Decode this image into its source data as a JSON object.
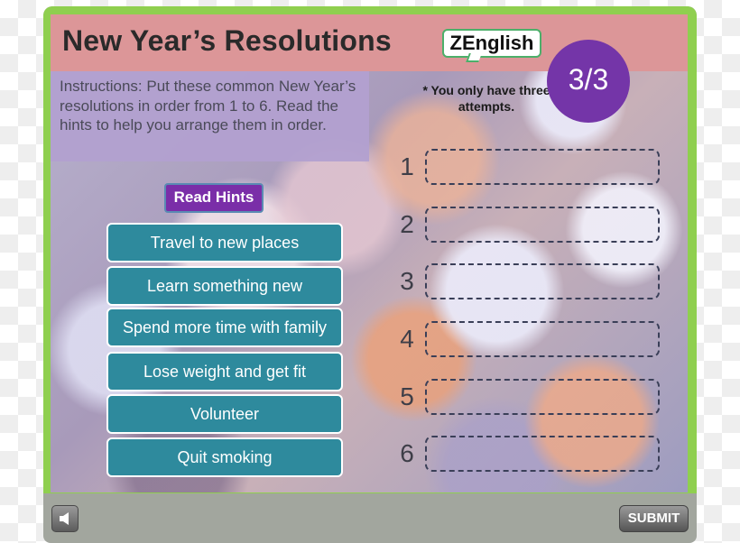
{
  "header": {
    "title": "New Year’s Resolutions",
    "logo_text": "ZEnglish"
  },
  "instructions": {
    "text": "Instructions: Put these common New Year’s resolutions in order from 1 to 6. Read the hints to help you arrange them in order."
  },
  "attempts": {
    "note": "* You only have three attempts.",
    "counter": "3/3"
  },
  "hints_button": {
    "label": "Read Hints"
  },
  "options": [
    {
      "label": "Travel to new places"
    },
    {
      "label": "Learn something new"
    },
    {
      "label": "Spend more time with family"
    },
    {
      "label": "Lose weight and get fit"
    },
    {
      "label": "Volunteer"
    },
    {
      "label": "Quit smoking"
    }
  ],
  "slots": [
    {
      "number": "1"
    },
    {
      "number": "2"
    },
    {
      "number": "3"
    },
    {
      "number": "4"
    },
    {
      "number": "5"
    },
    {
      "number": "6"
    }
  ],
  "footer": {
    "sound_icon": "speaker-icon",
    "submit_label": "SUBMIT"
  },
  "colors": {
    "frame_green": "#8fcf4f",
    "header_pink": "#dc9698",
    "instructions_purple": "#b2a0d0",
    "counter_purple": "#7435a8",
    "hints_purple": "#7a2ea8",
    "option_teal": "#2e8a9d",
    "footer_gray": "#a2a69e"
  }
}
